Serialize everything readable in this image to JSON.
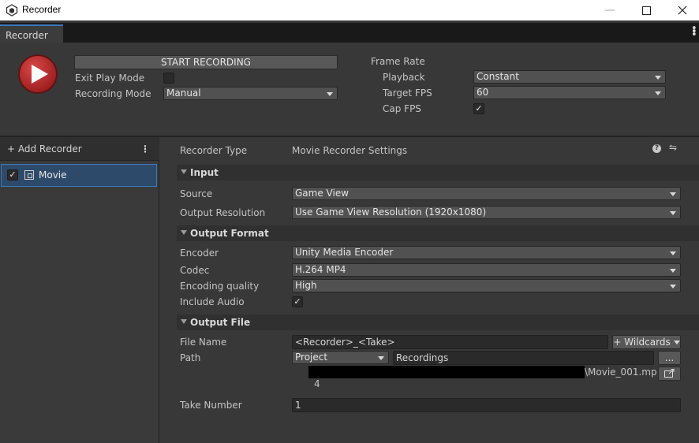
{
  "window": {
    "title": "Recorder",
    "tab": "Recorder"
  },
  "top": {
    "start_label": "START RECORDING",
    "exit_play_mode_label": "Exit Play Mode",
    "exit_play_mode_checked": false,
    "recording_mode_label": "Recording Mode",
    "recording_mode_value": "Manual",
    "frame_rate_label": "Frame Rate",
    "playback_label": "Playback",
    "playback_value": "Constant",
    "target_fps_label": "Target FPS",
    "target_fps_value": "60",
    "cap_fps_label": "Cap FPS",
    "cap_fps_checked": true
  },
  "left": {
    "add_recorder_label": "+ Add Recorder",
    "recorders": [
      {
        "name": "Movie",
        "enabled": true
      }
    ]
  },
  "main": {
    "recorder_type_label": "Recorder Type",
    "recorder_type_value": "Movie Recorder Settings",
    "input_section": "Input",
    "source_label": "Source",
    "source_value": "Game View",
    "output_resolution_label": "Output Resolution",
    "output_resolution_value": "Use Game View Resolution (1920x1080)",
    "output_format_section": "Output Format",
    "encoder_label": "Encoder",
    "encoder_value": "Unity Media Encoder",
    "codec_label": "Codec",
    "codec_value": "H.264 MP4",
    "encoding_quality_label": "Encoding quality",
    "encoding_quality_value": "High",
    "include_audio_label": "Include Audio",
    "include_audio_checked": true,
    "output_file_section": "Output File",
    "file_name_label": "File Name",
    "file_name_value": "<Recorder>_<Take>",
    "wildcards_label": "+ Wildcards",
    "path_label": "Path",
    "path_root_value": "Project",
    "path_value": "Recordings",
    "browse_label": "...",
    "output_path_tail": "\\Movie_001.mp",
    "output_path_wrap": "4",
    "take_number_label": "Take Number",
    "take_number_value": "1"
  },
  "colors": {
    "accent": "#3a79bb",
    "record_red": "#c23030"
  }
}
